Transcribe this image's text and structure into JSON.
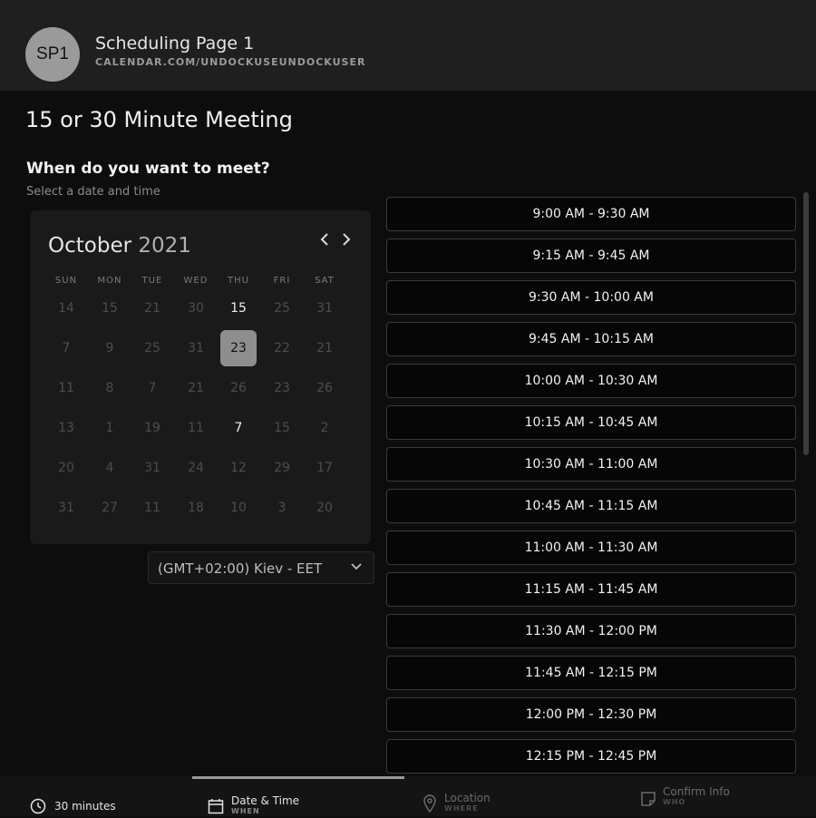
{
  "header": {
    "avatar_initials": "SP1",
    "page_name": "Scheduling Page 1",
    "page_url": "CALENDAR.COM/UNDOCKUSEUNDOCKUSER"
  },
  "meeting": {
    "title": "15 or 30 Minute Meeting",
    "question": "When do you want to meet?",
    "subtitle": "Select a date and time"
  },
  "calendar": {
    "month": "October",
    "year": "2021",
    "prev_icon": "chevron-left-icon",
    "next_icon": "chevron-right-icon",
    "weekdays": [
      "SUN",
      "MON",
      "TUE",
      "WED",
      "THU",
      "FRI",
      "SAT"
    ],
    "weeks": [
      [
        "14",
        "15",
        "21",
        "30",
        "15",
        "25",
        "31"
      ],
      [
        "7",
        "9",
        "25",
        "31",
        "23",
        "22",
        "21"
      ],
      [
        "11",
        "8",
        "7",
        "21",
        "26",
        "23",
        "26"
      ],
      [
        "13",
        "1",
        "19",
        "11",
        "7",
        "15",
        "2"
      ],
      [
        "20",
        "4",
        "31",
        "24",
        "12",
        "29",
        "17"
      ],
      [
        "31",
        "27",
        "11",
        "18",
        "10",
        "3",
        "20"
      ]
    ],
    "active_days": [
      "15",
      "23",
      "7"
    ],
    "selected_day": "23"
  },
  "timezone": {
    "value": "(GMT+02:00) Kiev - EET"
  },
  "time_slots": [
    "9:00 AM - 9:30 AM",
    "9:15 AM - 9:45 AM",
    "9:30 AM - 10:00 AM",
    "9:45 AM - 10:15 AM",
    "10:00 AM - 10:30 AM",
    "10:15 AM - 10:45 AM",
    "10:30 AM - 11:00 AM",
    "10:45 AM - 11:15 AM",
    "11:00 AM - 11:30 AM",
    "11:15 AM - 11:45 AM",
    "11:30 AM - 12:00 PM",
    "11:45 AM - 12:15 PM",
    "12:00 PM - 12:30 PM",
    "12:15 PM - 12:45 PM"
  ],
  "footer": {
    "steps": [
      {
        "label": "30 minutes",
        "sub": "",
        "icon": "clock-icon"
      },
      {
        "label": "Date & Time",
        "sub": "WHEN",
        "icon": "calendar-icon"
      },
      {
        "label": "Location",
        "sub": "WHERE",
        "icon": "location-pin-icon"
      },
      {
        "label": "Confirm Info",
        "sub": "WHO",
        "icon": "note-icon"
      }
    ],
    "progress": 0.26
  },
  "colors": {
    "background": "#0d0d0d",
    "header": "#1f1f1f",
    "selected_day": "#8e8e8e",
    "slot_border": "#3a3a3a"
  }
}
